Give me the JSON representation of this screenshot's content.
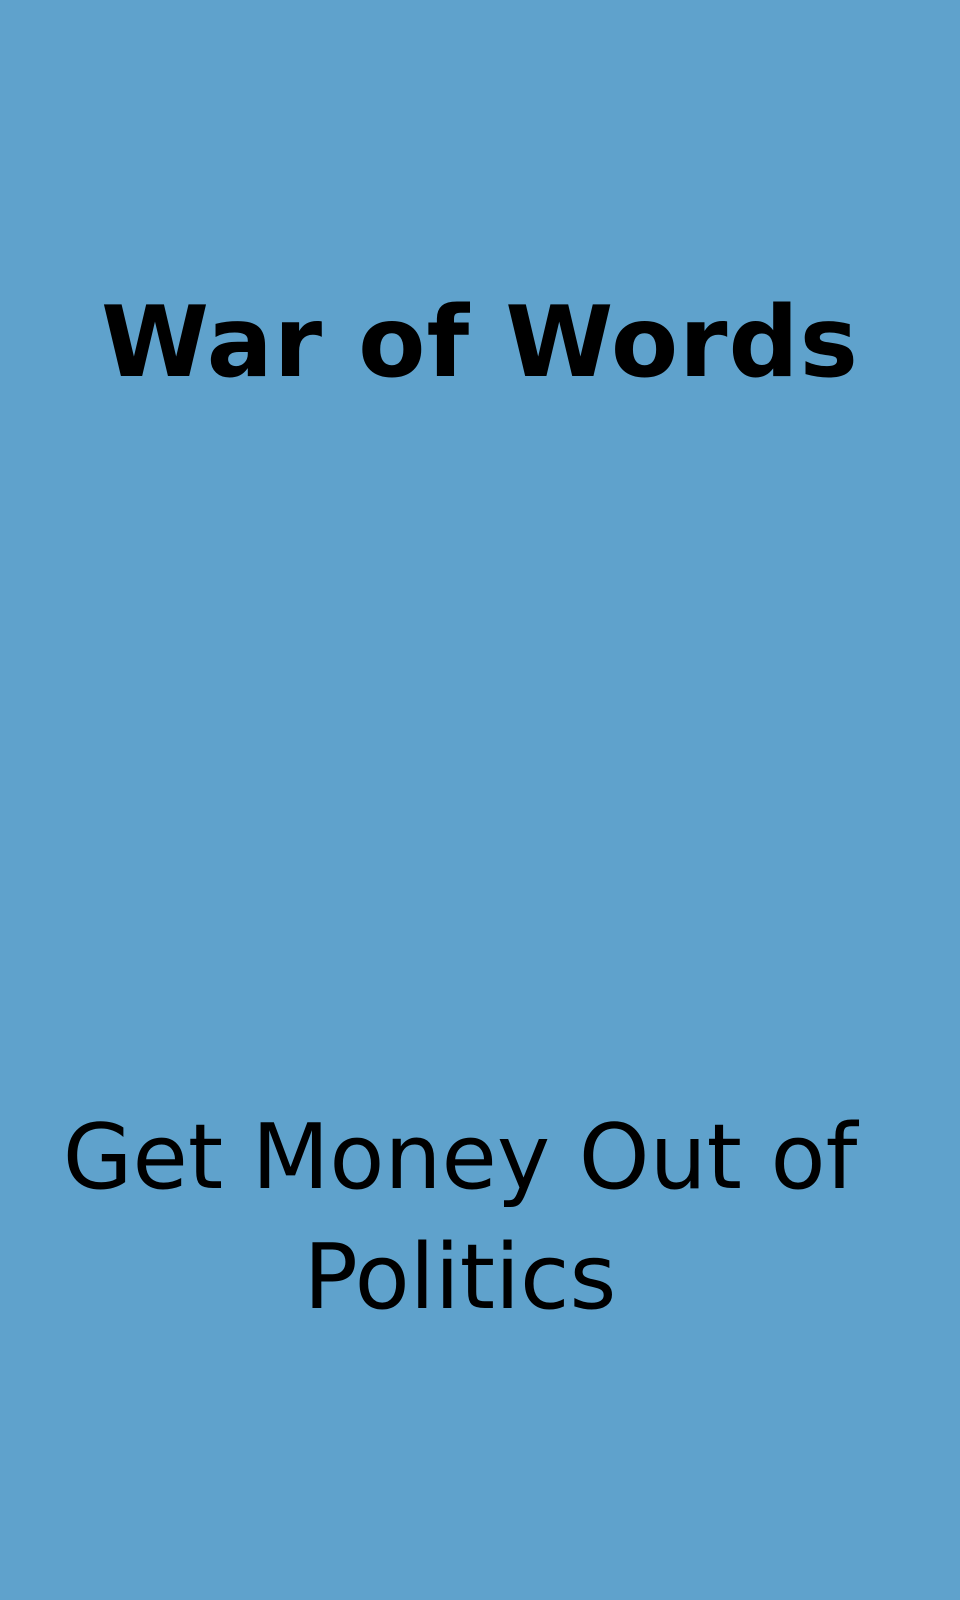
{
  "card": {
    "title": "War of Words",
    "text": "Get Money Out of Politics",
    "background_color": "#5fa2cc",
    "text_color": "#000000"
  }
}
